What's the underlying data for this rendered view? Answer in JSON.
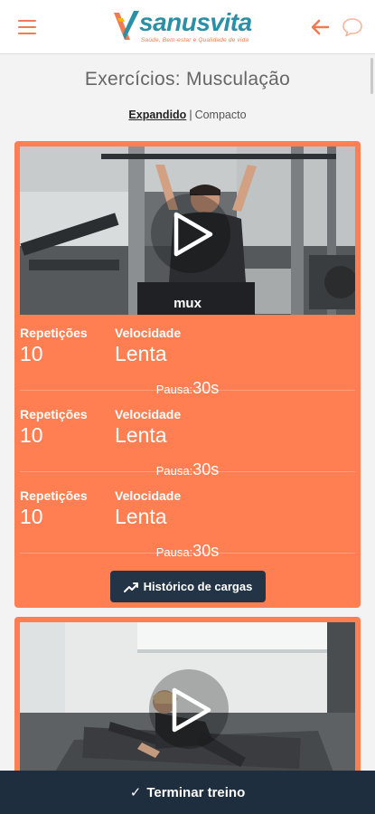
{
  "header": {
    "logo_text": "sanusvita",
    "logo_tagline": "Saúde, Bem-estar e Qualidade de vida",
    "colors": {
      "brand_teal": "#2b8fa6",
      "brand_orange": "#f07a52"
    },
    "icons": [
      "menu-icon",
      "back-arrow-icon",
      "chat-icon"
    ]
  },
  "page": {
    "title": "Exercícios: Musculação",
    "view_mode": {
      "active": "Expandido",
      "separator": "|",
      "inactive": "Compacto"
    }
  },
  "exercises": [
    {
      "video_label": "mux",
      "sets": [
        {
          "rep_label": "Repetições",
          "rep_value": "10",
          "speed_label": "Velocidade",
          "speed_value": "Lenta",
          "pause_label": "Pausa:",
          "pause_value": "30s"
        },
        {
          "rep_label": "Repetições",
          "rep_value": "10",
          "speed_label": "Velocidade",
          "speed_value": "Lenta",
          "pause_label": "Pausa:",
          "pause_value": "30s"
        },
        {
          "rep_label": "Repetições",
          "rep_value": "10",
          "speed_label": "Velocidade",
          "speed_value": "Lenta",
          "pause_label": "Pausa:",
          "pause_value": "30s"
        }
      ],
      "history_button": "Histórico de cargas"
    },
    {
      "video_label": ""
    }
  ],
  "footer": {
    "finish_button": "Terminar treino"
  },
  "theme": {
    "card_color": "#ff7f53",
    "dark_button": "#243447",
    "footer_bg": "#1f2e3f"
  }
}
